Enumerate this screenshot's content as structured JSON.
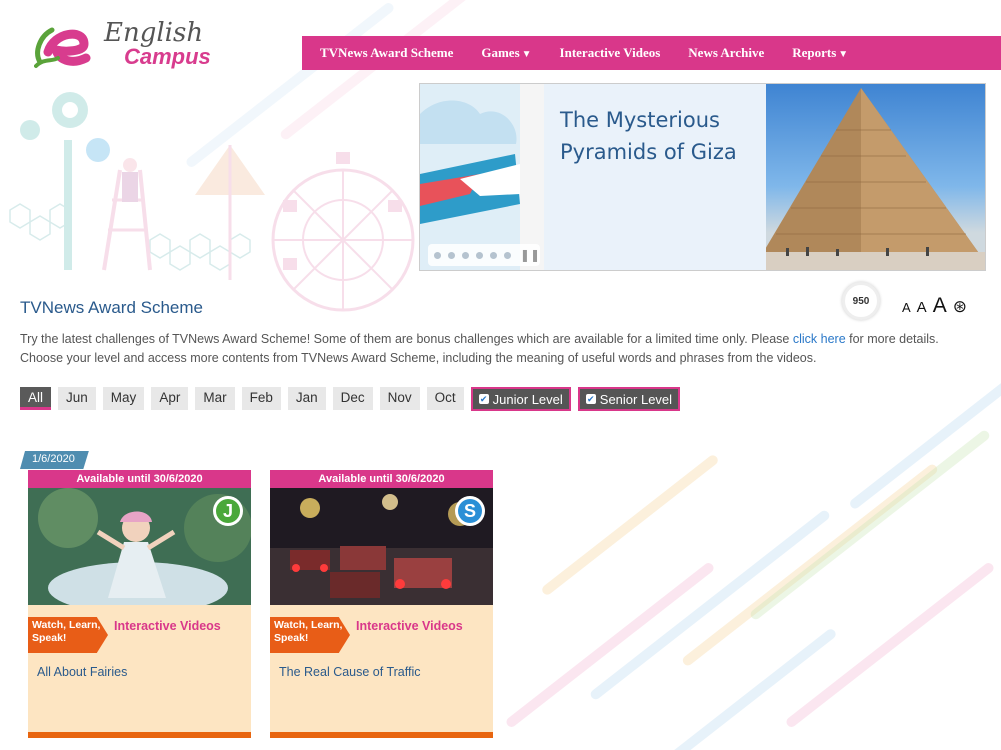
{
  "logo": {
    "line1": "English",
    "line2": "Campus"
  },
  "nav": [
    {
      "label": "TVNews Award Scheme",
      "caret": false
    },
    {
      "label": "Games",
      "caret": true
    },
    {
      "label": "Interactive Videos",
      "caret": false
    },
    {
      "label": "News Archive",
      "caret": false
    },
    {
      "label": "Reports",
      "caret": true
    }
  ],
  "banner": {
    "title_line1": "The Mysterious",
    "title_line2": "Pyramids of Giza",
    "pause": "❚❚"
  },
  "section": {
    "title": "TVNews Award Scheme",
    "badge": "950",
    "font_small": "A",
    "font_medium": "A",
    "font_large": "A",
    "contrast_icon": "⊛"
  },
  "description": {
    "part1": "Try the latest challenges of TVNews Award Scheme! Some of them are bonus challenges which are available for a limited time only. Please ",
    "link": "click here",
    "part2": " for more details. Choose your level and access more contents from TVNews Award Scheme, including the meaning of useful words and phrases from the videos."
  },
  "filters": [
    "All",
    "Jun",
    "May",
    "Apr",
    "Mar",
    "Feb",
    "Jan",
    "Dec",
    "Nov",
    "Oct"
  ],
  "levels": [
    {
      "label": "Junior Level",
      "checked": true
    },
    {
      "label": "Senior Level",
      "checked": true
    }
  ],
  "date_tag": "1/6/2020",
  "cards": [
    {
      "availability": "Available until 30/6/2020",
      "level_letter": "J",
      "level_color": "#4aa83a",
      "tag": "Watch, Learn, Speak!",
      "type": "Interactive Videos",
      "title": "All About Fairies"
    },
    {
      "availability": "Available until 30/6/2020",
      "level_letter": "S",
      "level_color": "#2a8fd6",
      "tag": "Watch, Learn, Speak!",
      "type": "Interactive Videos",
      "title": "The Real Cause of Traffic"
    }
  ],
  "colors": {
    "brand": "#d9378a",
    "heading": "#2a5a8c",
    "orange": "#e85d17"
  }
}
